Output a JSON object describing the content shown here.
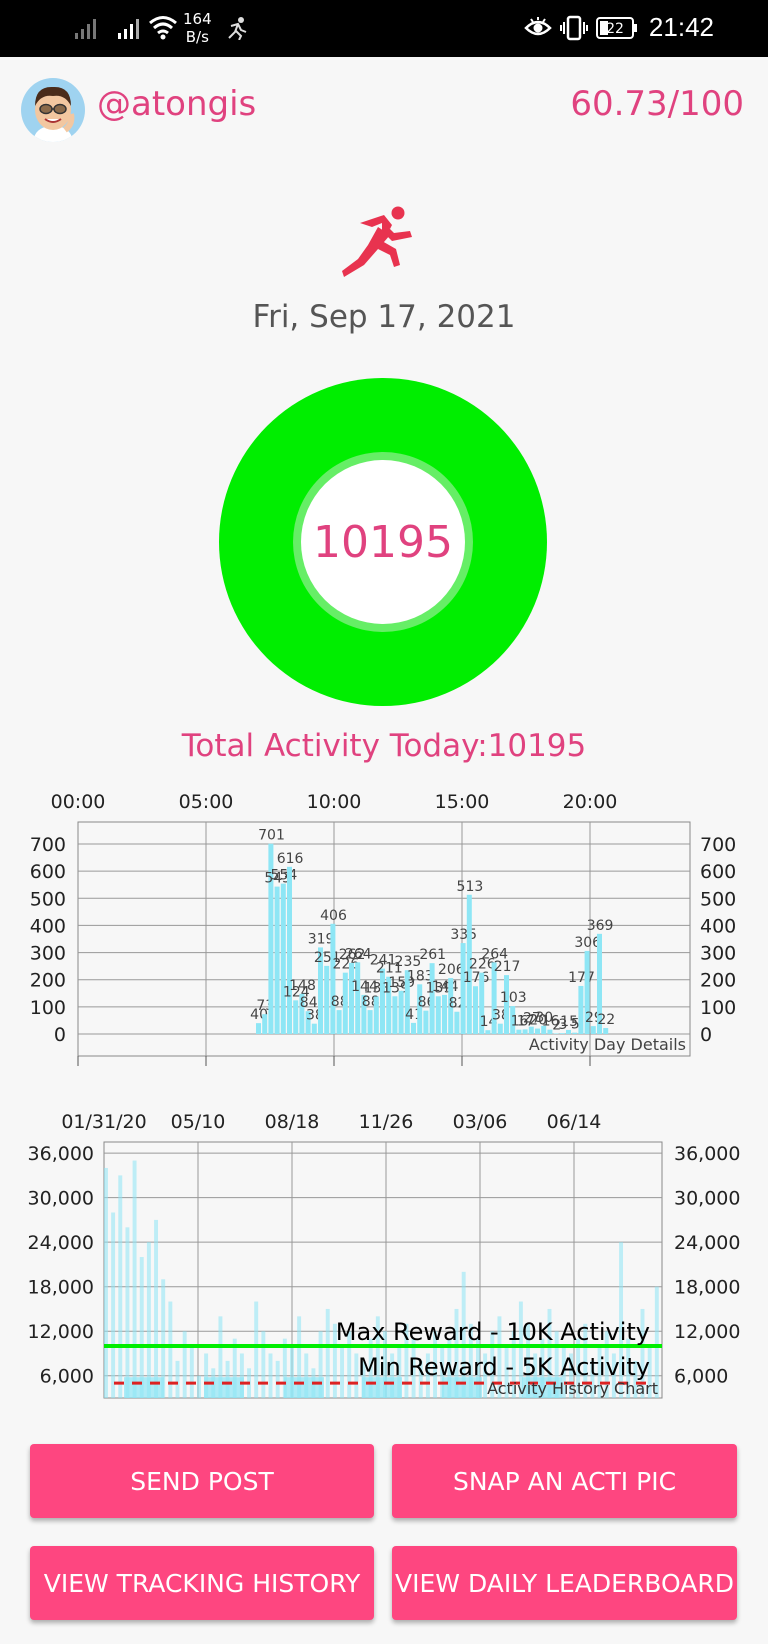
{
  "status_bar": {
    "net_speed_value": "164",
    "net_speed_unit": "B/s",
    "battery": "22",
    "time": "21:42"
  },
  "header": {
    "username": "@atongis",
    "score": "60.73/100"
  },
  "date": "Fri, Sep 17, 2021",
  "ring": {
    "value": "10195",
    "color": "#00ee00",
    "inner_color": "#66ee66"
  },
  "total_activity": "Total Activity Today:10195",
  "day_chart": {
    "chart_data": {
      "type": "bar",
      "label": "Activity Day Details",
      "x_ticks": [
        "00:00",
        "05:00",
        "10:00",
        "15:00",
        "20:00"
      ],
      "y_ticks": [
        "0",
        "100",
        "200",
        "300",
        "400",
        "500",
        "600",
        "700"
      ],
      "ylim": [
        0,
        700
      ],
      "grid": true,
      "bar_color": "#8ee6f5",
      "values": [
        40,
        73,
        701,
        543,
        554,
        616,
        124,
        148,
        84,
        38,
        319,
        251,
        406,
        88,
        226,
        262,
        264,
        144,
        88,
        138,
        241,
        211,
        139,
        159,
        235,
        41,
        183,
        86,
        261,
        139,
        144,
        206,
        82,
        335,
        513,
        176,
        226,
        14,
        264,
        38,
        217,
        103,
        16,
        17,
        27,
        20,
        30,
        16,
        2,
        3,
        15,
        5,
        177,
        306,
        29,
        369,
        22
      ]
    }
  },
  "history_chart": {
    "chart_data": {
      "type": "area",
      "label": "Activity History Chart",
      "x_ticks": [
        "01/31/20",
        "05/10",
        "08/18",
        "11/26",
        "03/06",
        "06/14"
      ],
      "y_ticks": [
        "6,000",
        "12,000",
        "18,000",
        "24,000",
        "30,000",
        "36,000"
      ],
      "ylim": [
        3000,
        37500
      ],
      "grid": true,
      "max_line": {
        "label": "Max Reward - 10K Activity",
        "value": 10000,
        "color": "#00ee00"
      },
      "min_line": {
        "label": "Min Reward - 5K Activity",
        "value": 5000,
        "color": "#dd2222"
      },
      "color": "#8ee6f5",
      "values": [
        34000,
        28000,
        33000,
        26000,
        35000,
        22000,
        24000,
        27000,
        19000,
        16000,
        8000,
        12000,
        10000,
        6000,
        9000,
        7000,
        14000,
        8000,
        11000,
        9000,
        7000,
        16000,
        12000,
        9000,
        8000,
        11000,
        10000,
        14000,
        9000,
        7000,
        12000,
        15000,
        13000,
        10000,
        12000,
        9000,
        8000,
        11000,
        14000,
        12000,
        9000,
        10000,
        13000,
        11000,
        8000,
        9000,
        12000,
        10000,
        11000,
        15000,
        20000,
        13000,
        11000,
        9000,
        12000,
        14000,
        10000,
        12000,
        16000,
        13000,
        9000,
        11000,
        15000,
        12000,
        10000,
        9000,
        11000,
        13000,
        8000,
        10000,
        12000,
        9000,
        24000,
        11000,
        8000,
        15000,
        10000,
        18000
      ]
    }
  },
  "buttons": {
    "send_post": "SEND POST",
    "snap_pic": "SNAP AN ACTI PIC",
    "tracking_history": "VIEW TRACKING HISTORY",
    "leaderboard": "VIEW DAILY LEADERBOARD"
  },
  "colors": {
    "accent": "#e0427f",
    "button": "#fe4680"
  }
}
